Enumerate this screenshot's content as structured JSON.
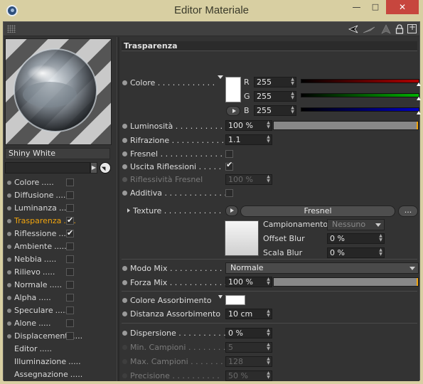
{
  "window": {
    "title": "Editor Materiale",
    "controls": {
      "minimize": "—",
      "maximize": "□",
      "close": "✕"
    }
  },
  "toolbar": {
    "icons": [
      "grip-icon",
      "arrow-left-icon",
      "arrow-right-icon",
      "arrow-up-icon",
      "lock-icon",
      "new-window-icon"
    ]
  },
  "material": {
    "name": "Shiny White",
    "search_value": ""
  },
  "channels": [
    {
      "label": "Colore",
      "has_check": true,
      "checked": false,
      "active": false
    },
    {
      "label": "Diffusione",
      "has_check": true,
      "checked": false,
      "active": false
    },
    {
      "label": "Luminanza",
      "has_check": true,
      "checked": false,
      "active": false
    },
    {
      "label": "Trasparenza",
      "has_check": true,
      "checked": true,
      "active": true
    },
    {
      "label": "Riflessione",
      "has_check": true,
      "checked": true,
      "active": false
    },
    {
      "label": "Ambiente",
      "has_check": true,
      "checked": false,
      "active": false
    },
    {
      "label": "Nebbia",
      "has_check": true,
      "checked": false,
      "active": false
    },
    {
      "label": "Rilievo",
      "has_check": true,
      "checked": false,
      "active": false
    },
    {
      "label": "Normale",
      "has_check": true,
      "checked": false,
      "active": false
    },
    {
      "label": "Alpha",
      "has_check": true,
      "checked": false,
      "active": false
    },
    {
      "label": "Speculare",
      "has_check": true,
      "checked": false,
      "active": false
    },
    {
      "label": "Alone",
      "has_check": true,
      "checked": false,
      "active": false
    },
    {
      "label": "Displacement",
      "has_check": true,
      "checked": false,
      "active": false
    },
    {
      "label": "Editor",
      "has_check": false,
      "checked": false,
      "active": false
    },
    {
      "label": "Illuminazione",
      "has_check": false,
      "checked": false,
      "active": false
    },
    {
      "label": "Assegnazione",
      "has_check": false,
      "checked": false,
      "active": false
    }
  ],
  "channel_dots": ".....",
  "panel": {
    "section_title": "Trasparenza",
    "colore": {
      "label": "Colore",
      "r_label": "R",
      "r_value": "255",
      "g_label": "G",
      "g_value": "255",
      "b_label": "B",
      "b_value": "255",
      "swatch_color": "#ffffff",
      "r_track_color": "#b00000",
      "g_track_color": "#00b000",
      "b_track_color": "#0000c0"
    },
    "luminosita": {
      "label": "Luminosità",
      "value": "100 %",
      "fill": 1.0
    },
    "rifrazione": {
      "label": "Rifrazione",
      "value": "1.1"
    },
    "fresnel": {
      "label": "Fresnel",
      "checked": false
    },
    "uscita_riflessioni": {
      "label": "Uscita Riflessioni",
      "checked": true
    },
    "riflessivita_fresnel": {
      "label": "Riflessività Fresnel",
      "value": "100 %"
    },
    "additiva": {
      "label": "Additiva",
      "checked": false
    },
    "texture": {
      "label": "Texture",
      "name": "Fresnel",
      "more": "...",
      "campionamento_label": "Campionamento",
      "campionamento_value": "Nessuno",
      "offset_blur_label": "Offset Blur",
      "offset_blur_value": "0 %",
      "scala_blur_label": "Scala Blur",
      "scala_blur_value": "0 %"
    },
    "modo_mix": {
      "label": "Modo Mix",
      "value": "Normale"
    },
    "forza_mix": {
      "label": "Forza Mix",
      "value": "100 %",
      "fill": 1.0
    },
    "colore_assorbimento": {
      "label": "Colore Assorbimento",
      "swatch_color": "#ffffff"
    },
    "distanza_assorbimento": {
      "label": "Distanza Assorbimento",
      "value": "10 cm"
    },
    "dispersione": {
      "label": "Dispersione",
      "value": "0 %"
    },
    "min_campioni": {
      "label": "Min. Campioni",
      "value": "5"
    },
    "max_campioni": {
      "label": "Max. Campioni",
      "value": "128"
    },
    "precisione": {
      "label": "Precisione",
      "value": "50 %"
    }
  },
  "colors": {
    "accent": "#f0a40e",
    "close_button": "#c7463e"
  }
}
